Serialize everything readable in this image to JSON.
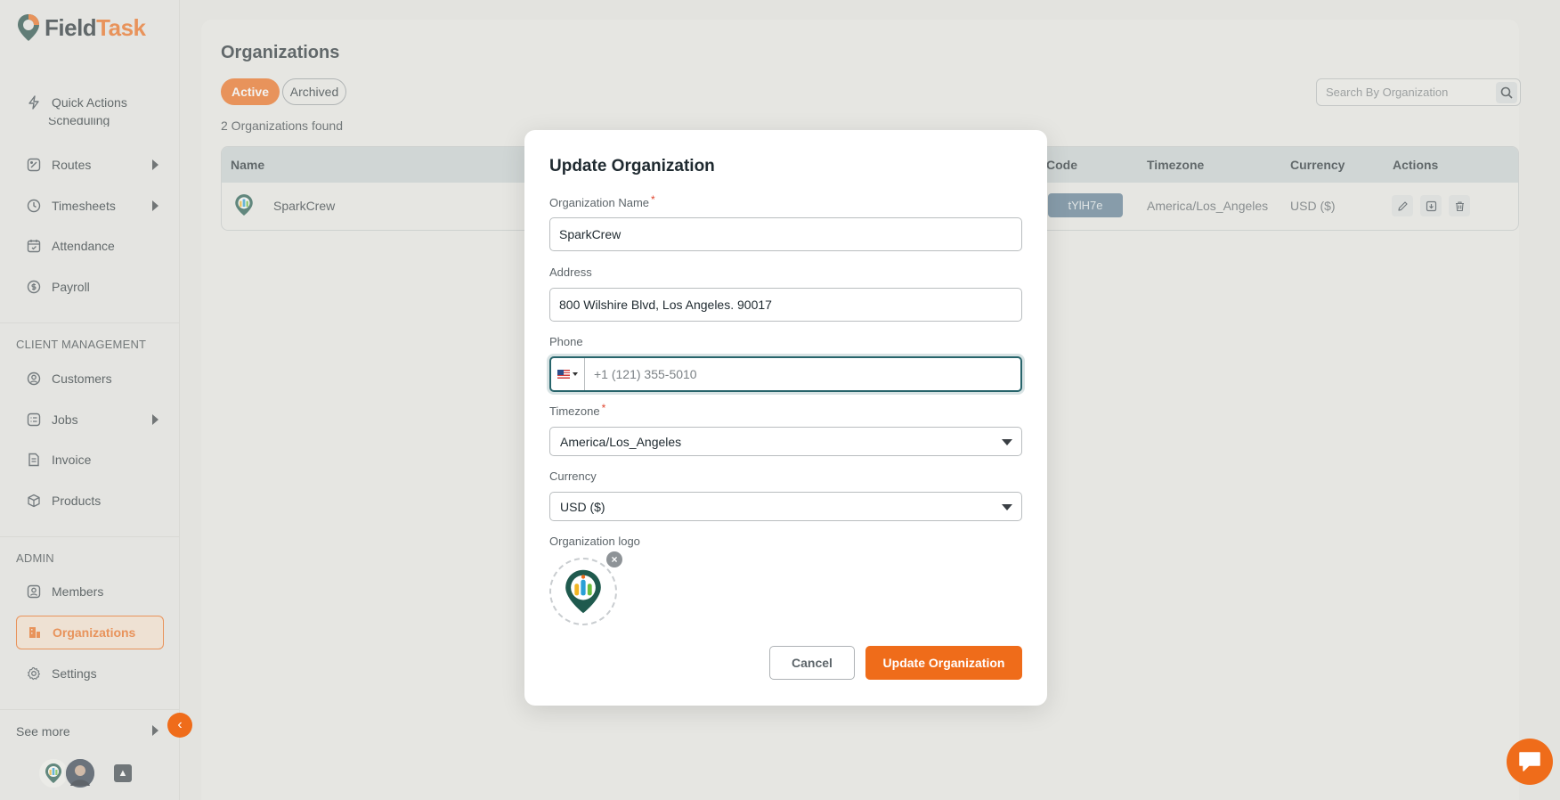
{
  "brand": {
    "name_part1": "Field",
    "name_part2": "Task",
    "accent": "#ef6c1a"
  },
  "sidebar": {
    "items": [
      {
        "label": "Quick Actions",
        "icon": "lightning-icon"
      },
      {
        "label": "Scheduling",
        "icon": "calendar-icon"
      },
      {
        "label": "Routes",
        "icon": "route-icon"
      },
      {
        "label": "Timesheets",
        "icon": "clock-icon"
      },
      {
        "label": "Attendance",
        "icon": "calendar-check-icon"
      },
      {
        "label": "Payroll",
        "icon": "dollar-icon"
      }
    ],
    "client_section": "CLIENT MANAGEMENT",
    "client_items": [
      {
        "label": "Customers",
        "icon": "user-circle-icon"
      },
      {
        "label": "Jobs",
        "icon": "list-icon"
      },
      {
        "label": "Invoice",
        "icon": "invoice-icon"
      },
      {
        "label": "Products",
        "icon": "box-icon"
      }
    ],
    "admin_section": "ADMIN",
    "admin_items": [
      {
        "label": "Members",
        "icon": "member-icon"
      },
      {
        "label": "Organizations",
        "icon": "building-icon"
      },
      {
        "label": "Settings",
        "icon": "gear-icon"
      }
    ],
    "see_more": "See more"
  },
  "page": {
    "title": "Organizations",
    "tabs": {
      "active": "Active",
      "archived": "Archived"
    },
    "found_text": "2 Organizations found",
    "search_placeholder": "Search By Organization"
  },
  "table": {
    "headers": {
      "name": "Name",
      "code": "Code",
      "timezone": "Timezone",
      "currency": "Currency",
      "actions": "Actions"
    },
    "rows": [
      {
        "name": "SparkCrew",
        "code": "tYlH7e",
        "timezone": "America/Los_Angeles",
        "currency": "USD ($)"
      }
    ]
  },
  "modal": {
    "title": "Update Organization",
    "org_name_label": "Organization Name",
    "org_name_value": "SparkCrew",
    "address_label": "Address",
    "address_value": "800 Wilshire Blvd, Los Angeles. 90017",
    "phone_label": "Phone",
    "phone_value": "+1 (121) 355-5010",
    "timezone_label": "Timezone",
    "timezone_value": "America/Los_Angeles",
    "currency_label": "Currency",
    "currency_value": "USD ($)",
    "logo_label": "Organization logo",
    "required_mark": "*",
    "cancel": "Cancel",
    "submit": "Update Organization"
  }
}
